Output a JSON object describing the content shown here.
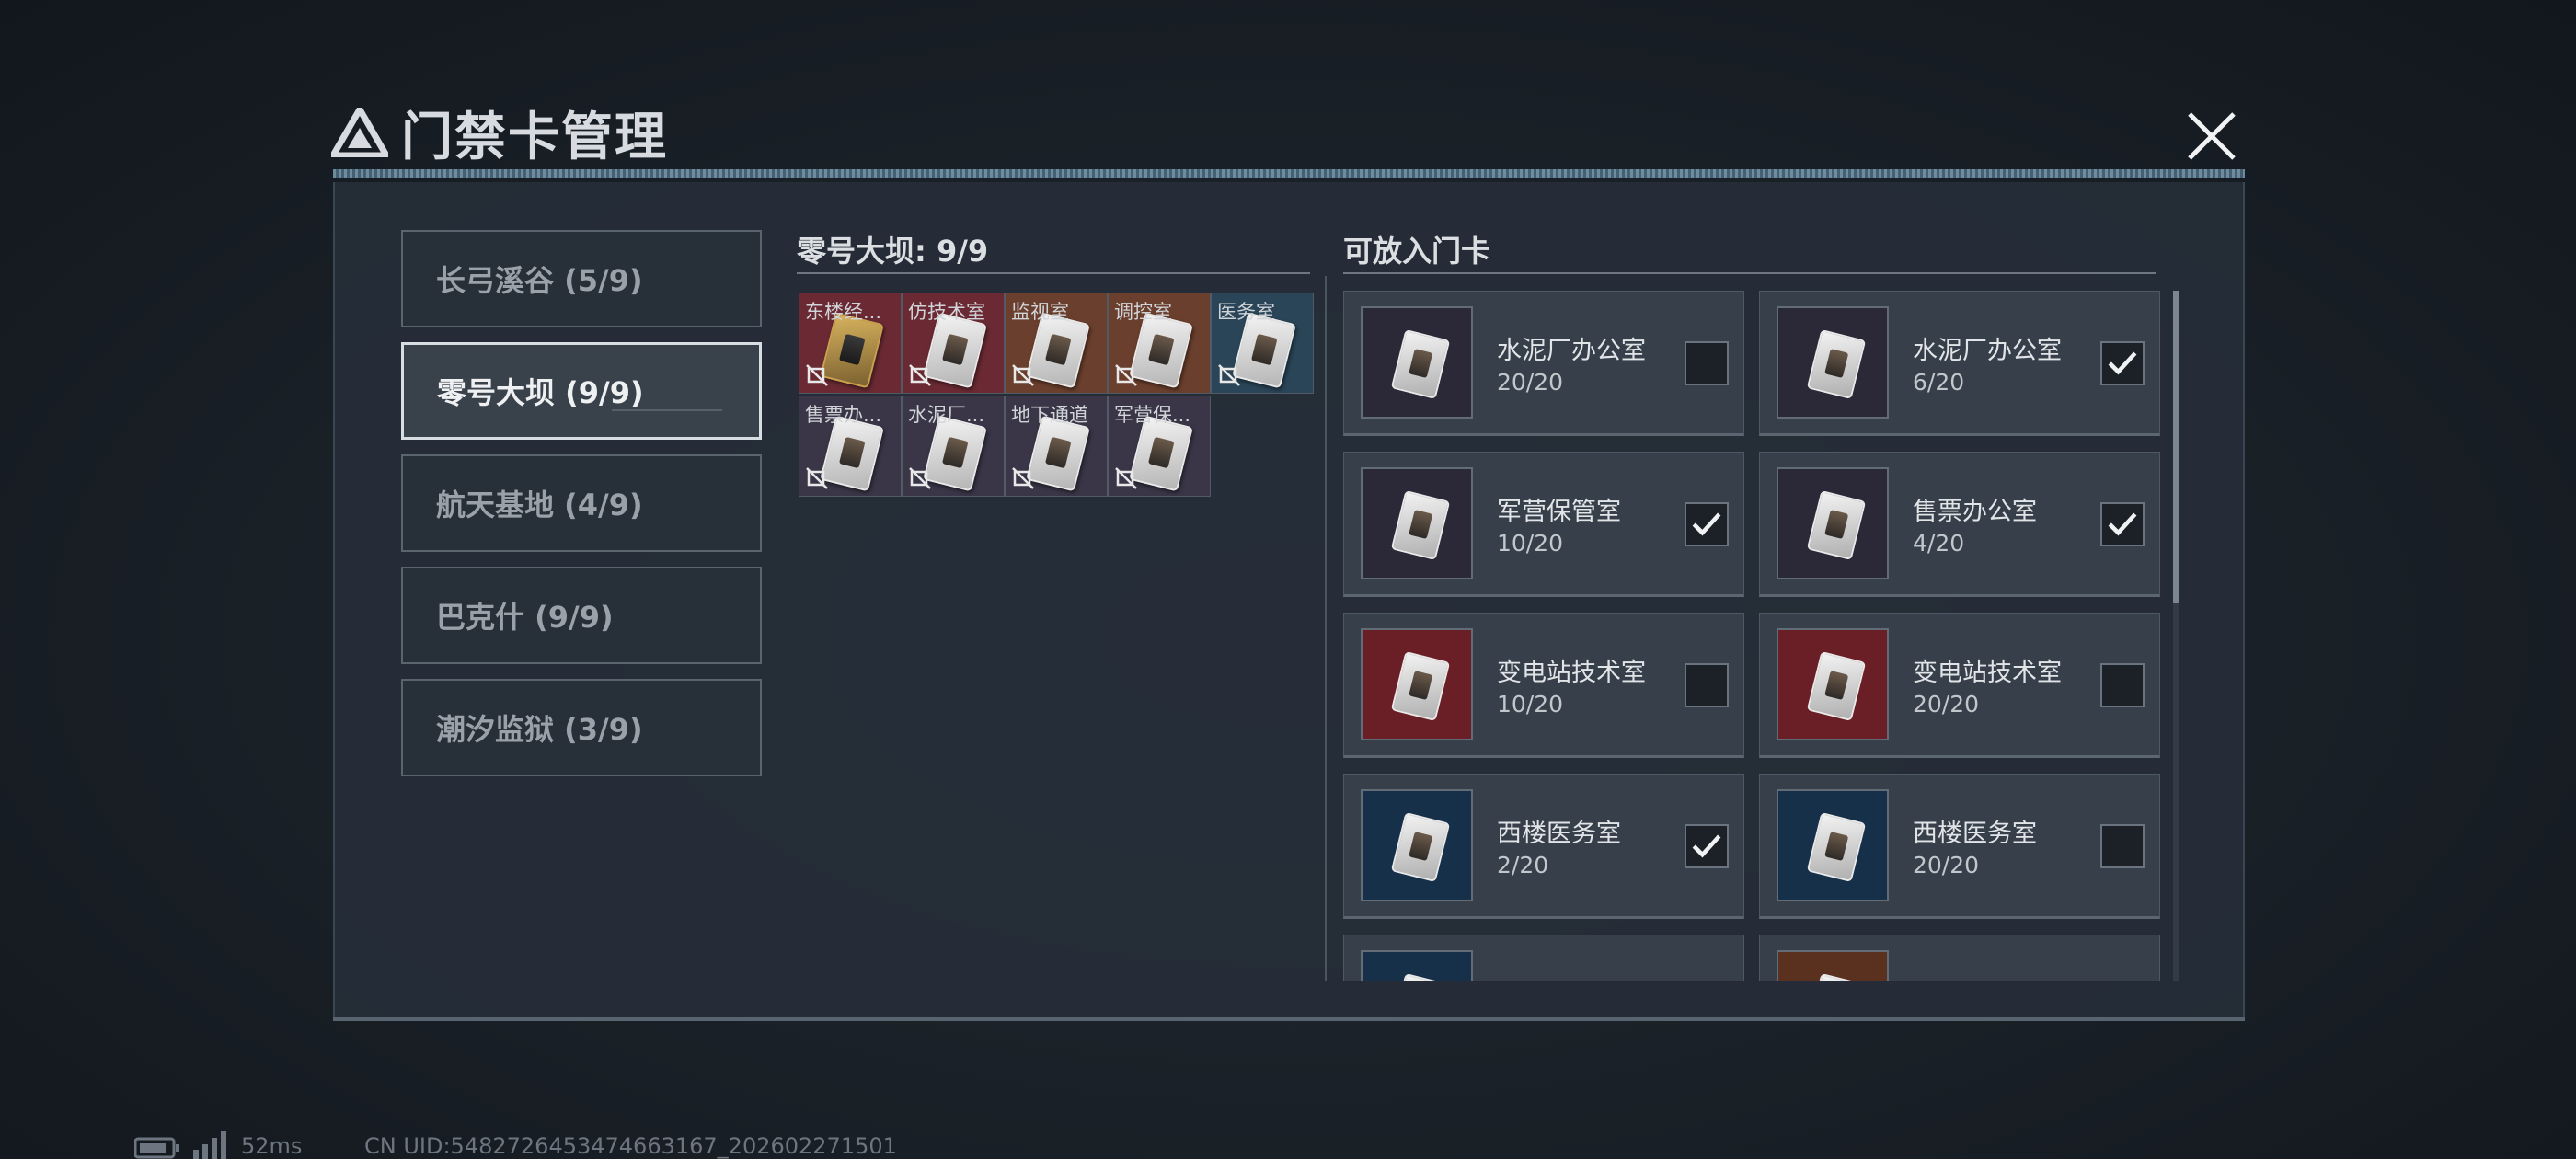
{
  "title": "门禁卡管理",
  "title_tiny": "",
  "colors": {
    "slot_red": "#6b2a33",
    "slot_brown": "#6b3f2d",
    "slot_blue": "#2a4557",
    "slot_purple": "#3a3648",
    "thumb_purple": "#2b2838",
    "thumb_red": "#6a1f26",
    "thumb_blue": "#16304a",
    "thumb_brown": "#5a301f"
  },
  "tabs": [
    {
      "label": "长弓溪谷 (5/9)",
      "active": false
    },
    {
      "label": "零号大坝 (9/9)",
      "active": true
    },
    {
      "label": "航天基地 (4/9)",
      "active": false
    },
    {
      "label": "巴克什 (9/9)",
      "active": false
    },
    {
      "label": "潮汐监狱 (3/9)",
      "active": false
    }
  ],
  "slots_title": "零号大坝: 9/9",
  "slots": [
    {
      "label": "东楼经...",
      "color": "red",
      "gold": true
    },
    {
      "label": "仿技术室",
      "color": "red",
      "gold": false
    },
    {
      "label": "监视室",
      "color": "brown",
      "gold": false
    },
    {
      "label": "调控室",
      "color": "brown",
      "gold": false
    },
    {
      "label": "医务室",
      "color": "blue",
      "gold": false
    },
    {
      "label": "售票办...",
      "color": "purple",
      "gold": false
    },
    {
      "label": "水泥厂...",
      "color": "purple",
      "gold": false
    },
    {
      "label": "地下通道",
      "color": "purple",
      "gold": false
    },
    {
      "label": "军营保...",
      "color": "purple",
      "gold": false
    }
  ],
  "available_title": "可放入门卡",
  "available_cards": [
    {
      "name": "水泥厂办公室",
      "count": "20/20",
      "checked": false,
      "color": "purple"
    },
    {
      "name": "水泥厂办公室",
      "count": "6/20",
      "checked": true,
      "color": "purple"
    },
    {
      "name": "军营保管室",
      "count": "10/20",
      "checked": true,
      "color": "purple"
    },
    {
      "name": "售票办公室",
      "count": "4/20",
      "checked": true,
      "color": "purple"
    },
    {
      "name": "变电站技术室",
      "count": "10/20",
      "checked": false,
      "color": "red"
    },
    {
      "name": "变电站技术室",
      "count": "20/20",
      "checked": false,
      "color": "red"
    },
    {
      "name": "西楼医务室",
      "count": "2/20",
      "checked": true,
      "color": "blue"
    },
    {
      "name": "西楼医务室",
      "count": "20/20",
      "checked": false,
      "color": "blue"
    },
    {
      "name": "",
      "count": "",
      "checked": false,
      "color": "blue"
    },
    {
      "name": "",
      "count": "",
      "checked": false,
      "color": "brown"
    }
  ],
  "status": {
    "ping": "52ms",
    "uid": "CN UID:5482726453474663167_202602271501"
  }
}
